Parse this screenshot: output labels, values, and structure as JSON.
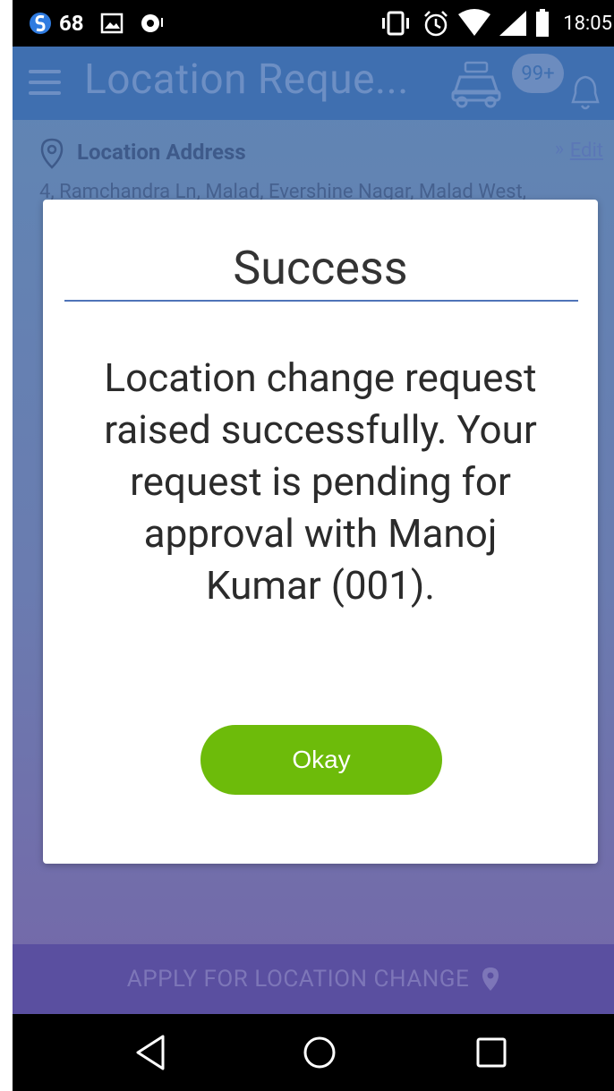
{
  "status_bar": {
    "count": "68",
    "time": "18:05",
    "icons": [
      "app-logo-icon",
      "image-icon",
      "record-icon",
      "vibrate-icon",
      "alarm-icon",
      "wifi-icon",
      "signal-icon",
      "battery-icon"
    ]
  },
  "app_bar": {
    "title": "Location Reque...",
    "badge": "99+"
  },
  "location": {
    "label": "Location Address",
    "edit": "Edit",
    "address": "4, Ramchandra Ln, Malad, Evershine Nagar, Malad West,"
  },
  "dialog": {
    "title": "Success",
    "message": "Location change request raised successfully. Your request is pending for approval with Manoj Kumar (001).",
    "button": "Okay"
  },
  "bottom_action": {
    "label": "APPLY FOR LOCATION CHANGE"
  },
  "colors": {
    "accent": "#4f74b8",
    "button": "#6dbb0a",
    "app_bar": "#3f6fb0"
  }
}
